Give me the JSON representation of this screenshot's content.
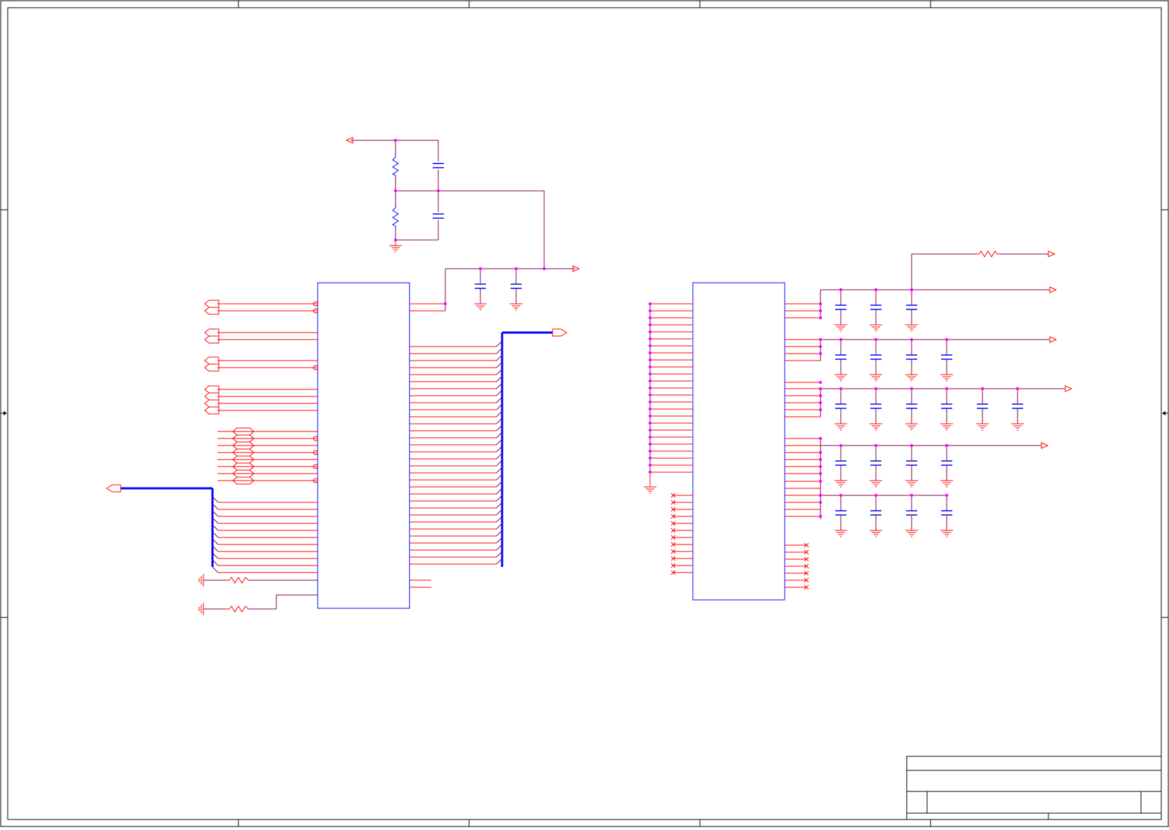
{
  "sheet": {
    "title_block": {
      "title": "",
      "size": "",
      "document_number": "",
      "revision": "",
      "date": "",
      "sheet": ""
    }
  },
  "colors": {
    "background": "#ffffff",
    "frame": "#000000",
    "component_body": "#0000ff",
    "pin_and_port": "#ff0000",
    "wire": "#800040",
    "junction": "#ff00ff",
    "bus": "#0000ff"
  },
  "components": {
    "left_ic": "",
    "right_ic": ""
  },
  "icons": {
    "ground": "ground-icon",
    "resistor": "resistor-icon",
    "capacitor": "capacitor-icon",
    "power_port": "power-port-icon",
    "off_sheet_connector": "off-sheet-connector-icon",
    "no_connect": "no-connect-icon"
  }
}
